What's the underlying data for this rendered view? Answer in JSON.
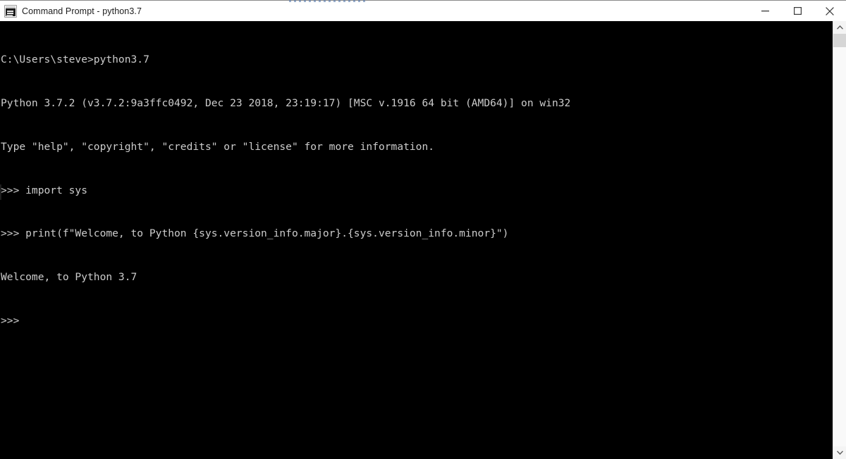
{
  "window": {
    "title": "Command Prompt - python3.7",
    "icon": "console-icon",
    "colors": {
      "titlebar_bg": "#ffffff",
      "title_text": "#1b1b1b",
      "console_bg": "#000000",
      "console_text": "#cccccc",
      "scrollbar_track": "#f9f9f9",
      "scrollbar_thumb": "#d6d6d6"
    },
    "controls": {
      "minimize": "Minimize",
      "maximize": "Maximize",
      "close": "Close"
    }
  },
  "console": {
    "lines": [
      "C:\\Users\\steve>python3.7",
      "Python 3.7.2 (v3.7.2:9a3ffc0492, Dec 23 2018, 23:19:17) [MSC v.1916 64 bit (AMD64)] on win32",
      "Type \"help\", \"copyright\", \"credits\" or \"license\" for more information.",
      ">>> import sys",
      ">>> print(f\"Welcome, to Python {sys.version_info.major}.{sys.version_info.minor}\")",
      "Welcome, to Python 3.7",
      ">>>"
    ]
  },
  "scrollbar": {
    "up_arrow": "scroll-up",
    "down_arrow": "scroll-down",
    "thumb": "scroll-thumb"
  }
}
